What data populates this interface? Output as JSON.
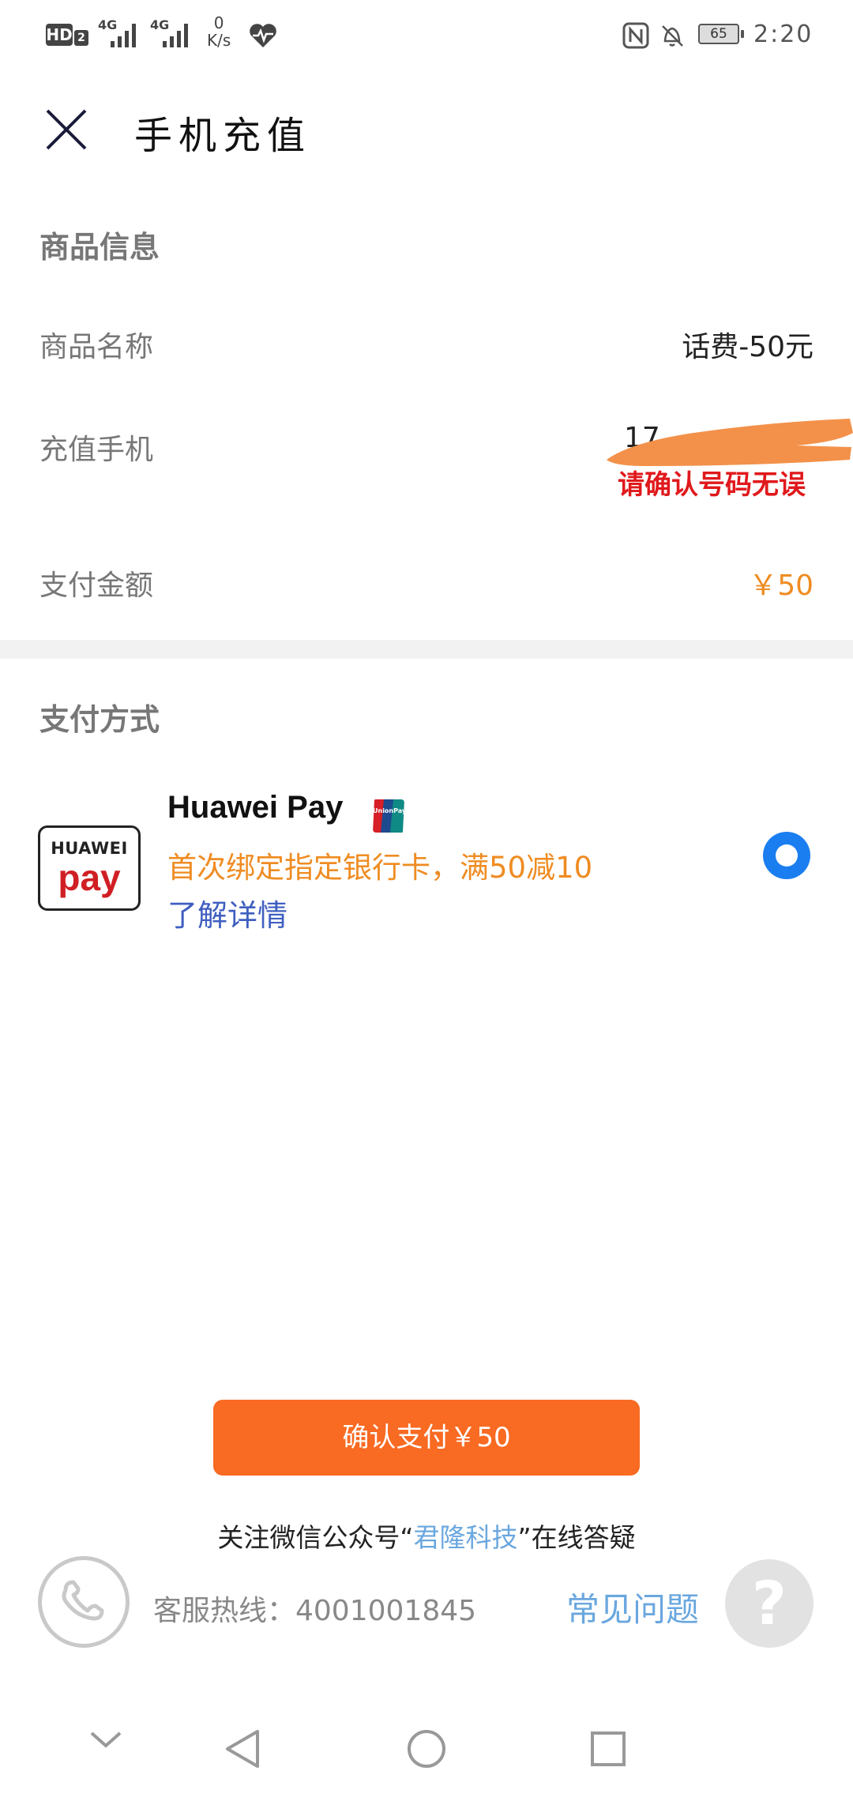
{
  "status_bar": {
    "hd_label": "HD",
    "hd_sub": "2",
    "net1": "4G",
    "net2": "4G",
    "speed_value": "0",
    "speed_unit": "K/s",
    "battery": "65",
    "time": "2:20"
  },
  "header": {
    "title": "手机充值"
  },
  "product_section": {
    "title": "商品信息",
    "rows": [
      {
        "label": "商品名称",
        "value": "话费-50元"
      },
      {
        "label": "充值手机",
        "value": "17",
        "note": "请确认号码无误"
      },
      {
        "label": "支付金额",
        "value": "￥50"
      }
    ]
  },
  "payment_section": {
    "title": "支付方式",
    "method": {
      "logo_line1": "HUAWEI",
      "logo_line2": "pay",
      "name": "Huawei Pay",
      "badge_text": "UnionPay",
      "promo": "首次绑定指定银行卡，满50减10",
      "link": "了解详情",
      "selected": true
    }
  },
  "confirm_button": {
    "label": "确认支付￥50"
  },
  "footer": {
    "wechat_prefix": "关注微信公众号“",
    "wechat_name": "君隆科技",
    "wechat_suffix": "”在线答疑",
    "hotline": "客服热线：4001001845",
    "faq": "常见问题",
    "help_glyph": "?"
  },
  "colors": {
    "accent_orange": "#ef8c22",
    "button_orange": "#f96a22",
    "radio_blue": "#1a7ef0",
    "link_blue": "#3f5fc0",
    "link_light_blue": "#6aa7df",
    "warning_red": "#e0191c"
  },
  "icons": {
    "close": "close-icon",
    "phone": "phone-icon",
    "help": "question-icon"
  }
}
